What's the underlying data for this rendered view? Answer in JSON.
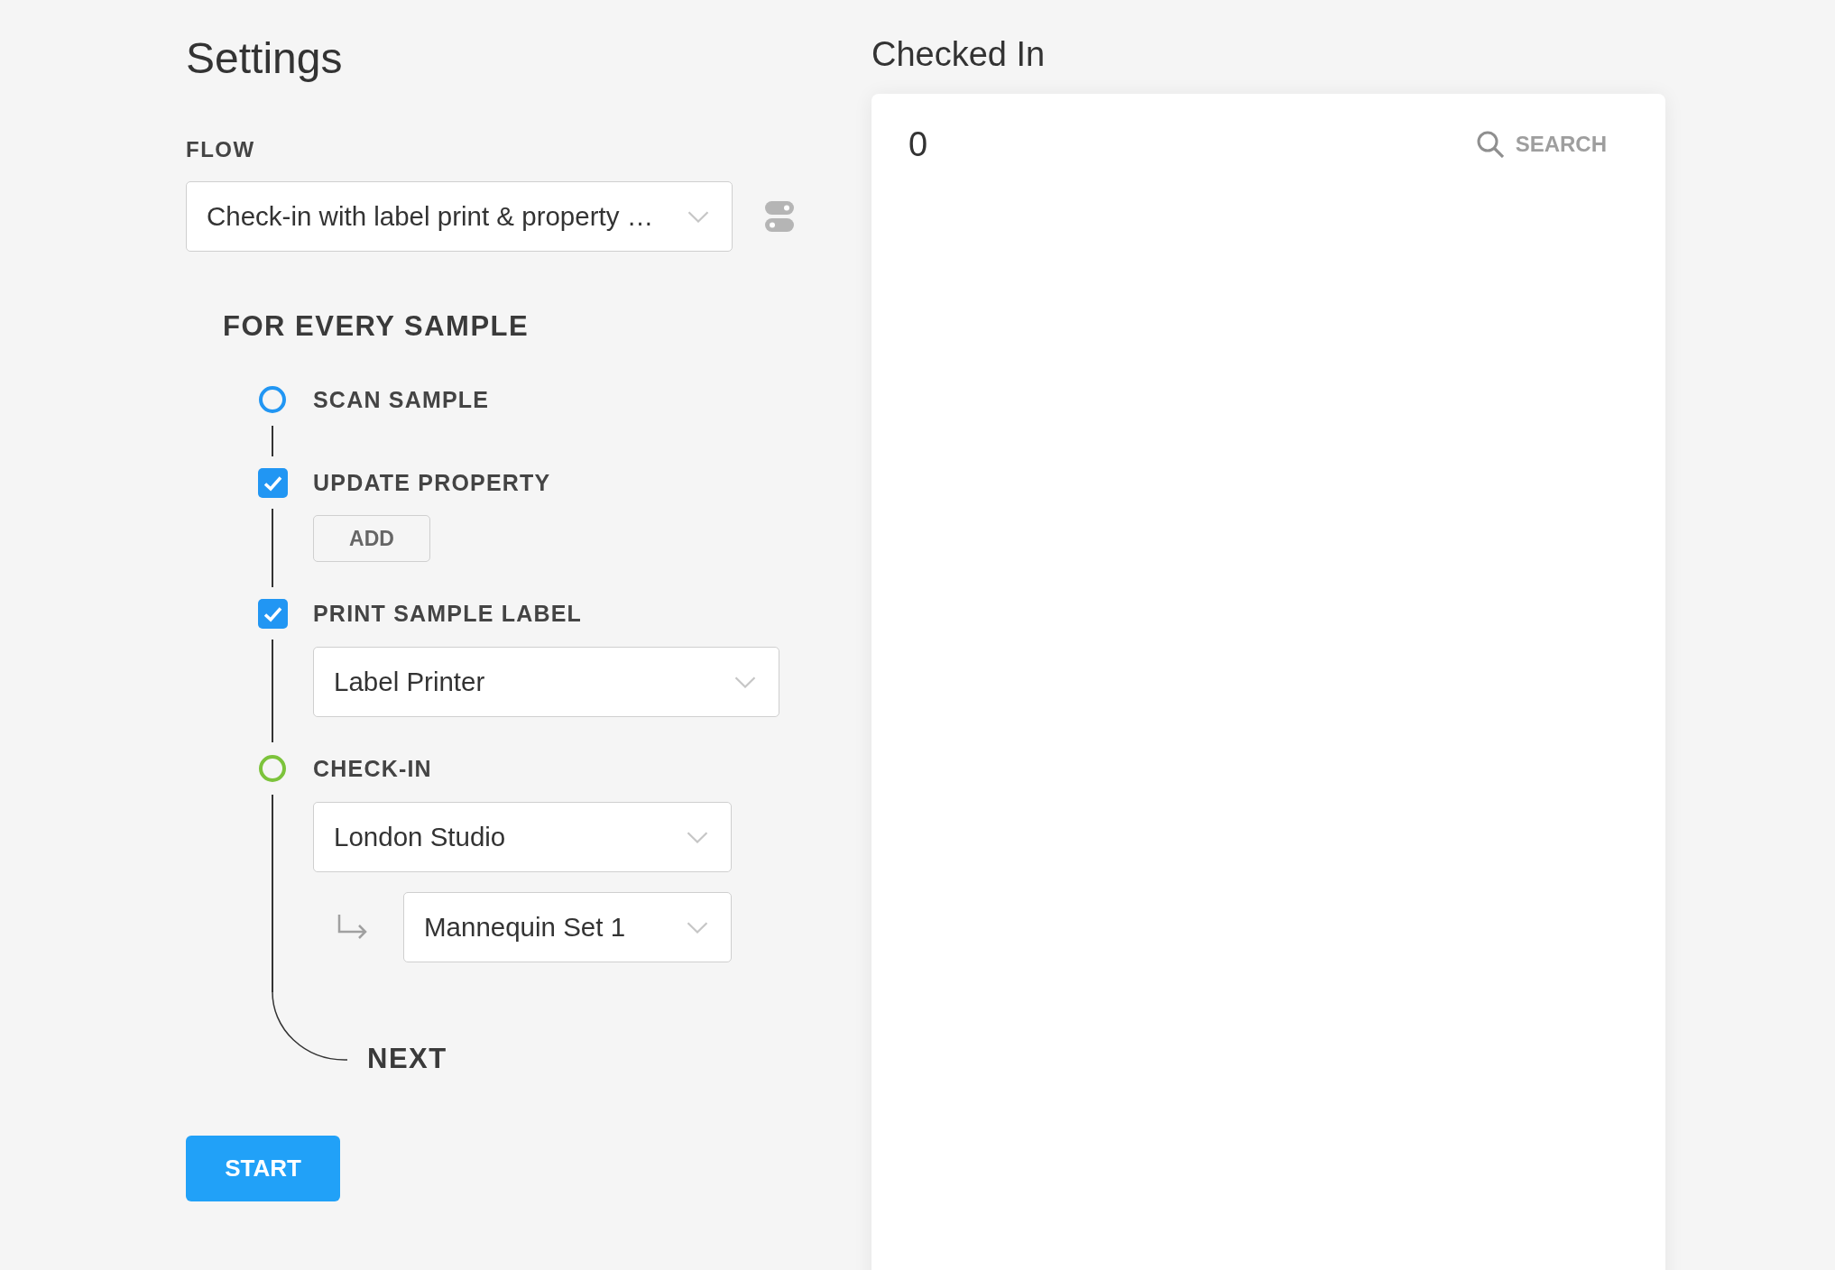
{
  "settings": {
    "title": "Settings",
    "flow": {
      "label": "FLOW",
      "value": "Check-in with label print & property …"
    },
    "loop_title": "FOR EVERY SAMPLE",
    "steps": [
      {
        "kind": "ring",
        "title": "SCAN SAMPLE",
        "color": "#2196f3"
      },
      {
        "kind": "checkbox",
        "title": "UPDATE PROPERTY",
        "checked": true,
        "button": "ADD"
      },
      {
        "kind": "checkbox",
        "title": "PRINT SAMPLE LABEL",
        "checked": true,
        "selects": [
          {
            "value": "Label Printer",
            "nested": false
          }
        ]
      },
      {
        "kind": "ring",
        "title": "CHECK-IN",
        "color": "#7cc33b",
        "selects": [
          {
            "value": "London Studio",
            "nested": false
          },
          {
            "value": "Mannequin Set 1",
            "nested": true
          }
        ]
      }
    ],
    "next_label": "NEXT",
    "start_button": "START"
  },
  "checked_in": {
    "title": "Checked In",
    "count": "0",
    "search_label": "SEARCH"
  }
}
